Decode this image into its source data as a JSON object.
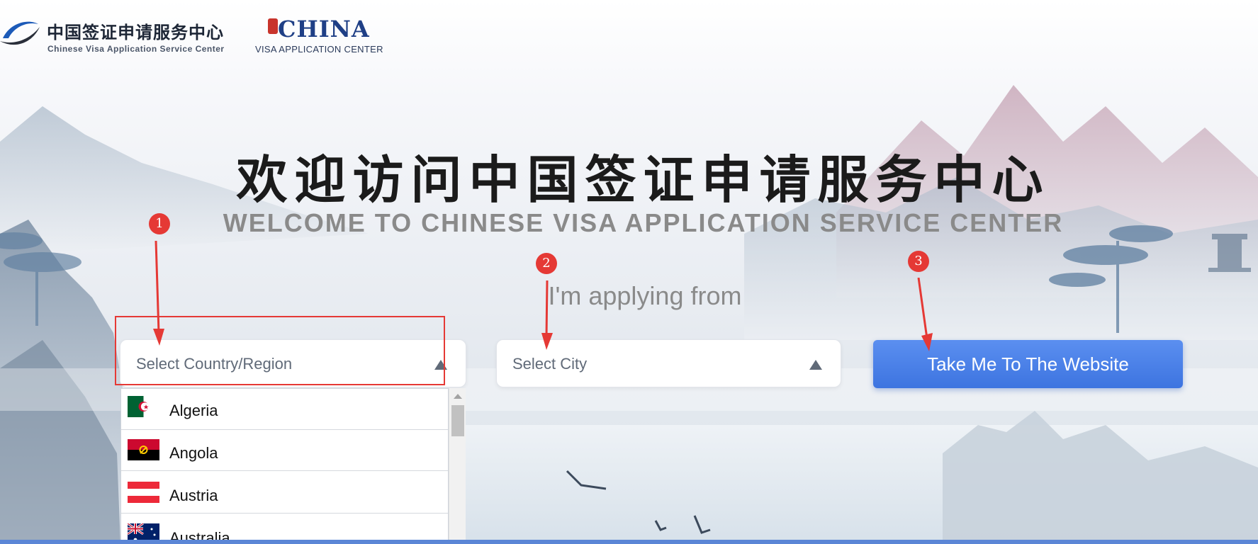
{
  "header": {
    "logo_left": {
      "cn_text": "中国签证申请服务中心",
      "en_text": "Chinese Visa Application Service Center"
    },
    "logo_right": {
      "word": "CHINA",
      "sub_text": "VISA APPLICATION CENTER"
    }
  },
  "hero": {
    "title_cn": "欢迎访问中国签证申请服务中心",
    "title_en": "WELCOME TO CHINESE VISA APPLICATION SERVICE CENTER",
    "applying_label": "I'm applying from"
  },
  "form": {
    "country_placeholder": "Select Country/Region",
    "city_placeholder": "Select City",
    "submit_label": "Take Me To The Website"
  },
  "dropdown": {
    "items": [
      {
        "label": "Algeria"
      },
      {
        "label": "Angola"
      },
      {
        "label": "Austria"
      },
      {
        "label": "Australia"
      }
    ]
  },
  "annotations": {
    "step1": "1",
    "step2": "2",
    "step3": "3",
    "marker_color": "#e53935"
  },
  "colors": {
    "primary_button": "#3d74e0",
    "title_text": "#1b1b1b",
    "subtitle_text": "#8a8a8a"
  }
}
